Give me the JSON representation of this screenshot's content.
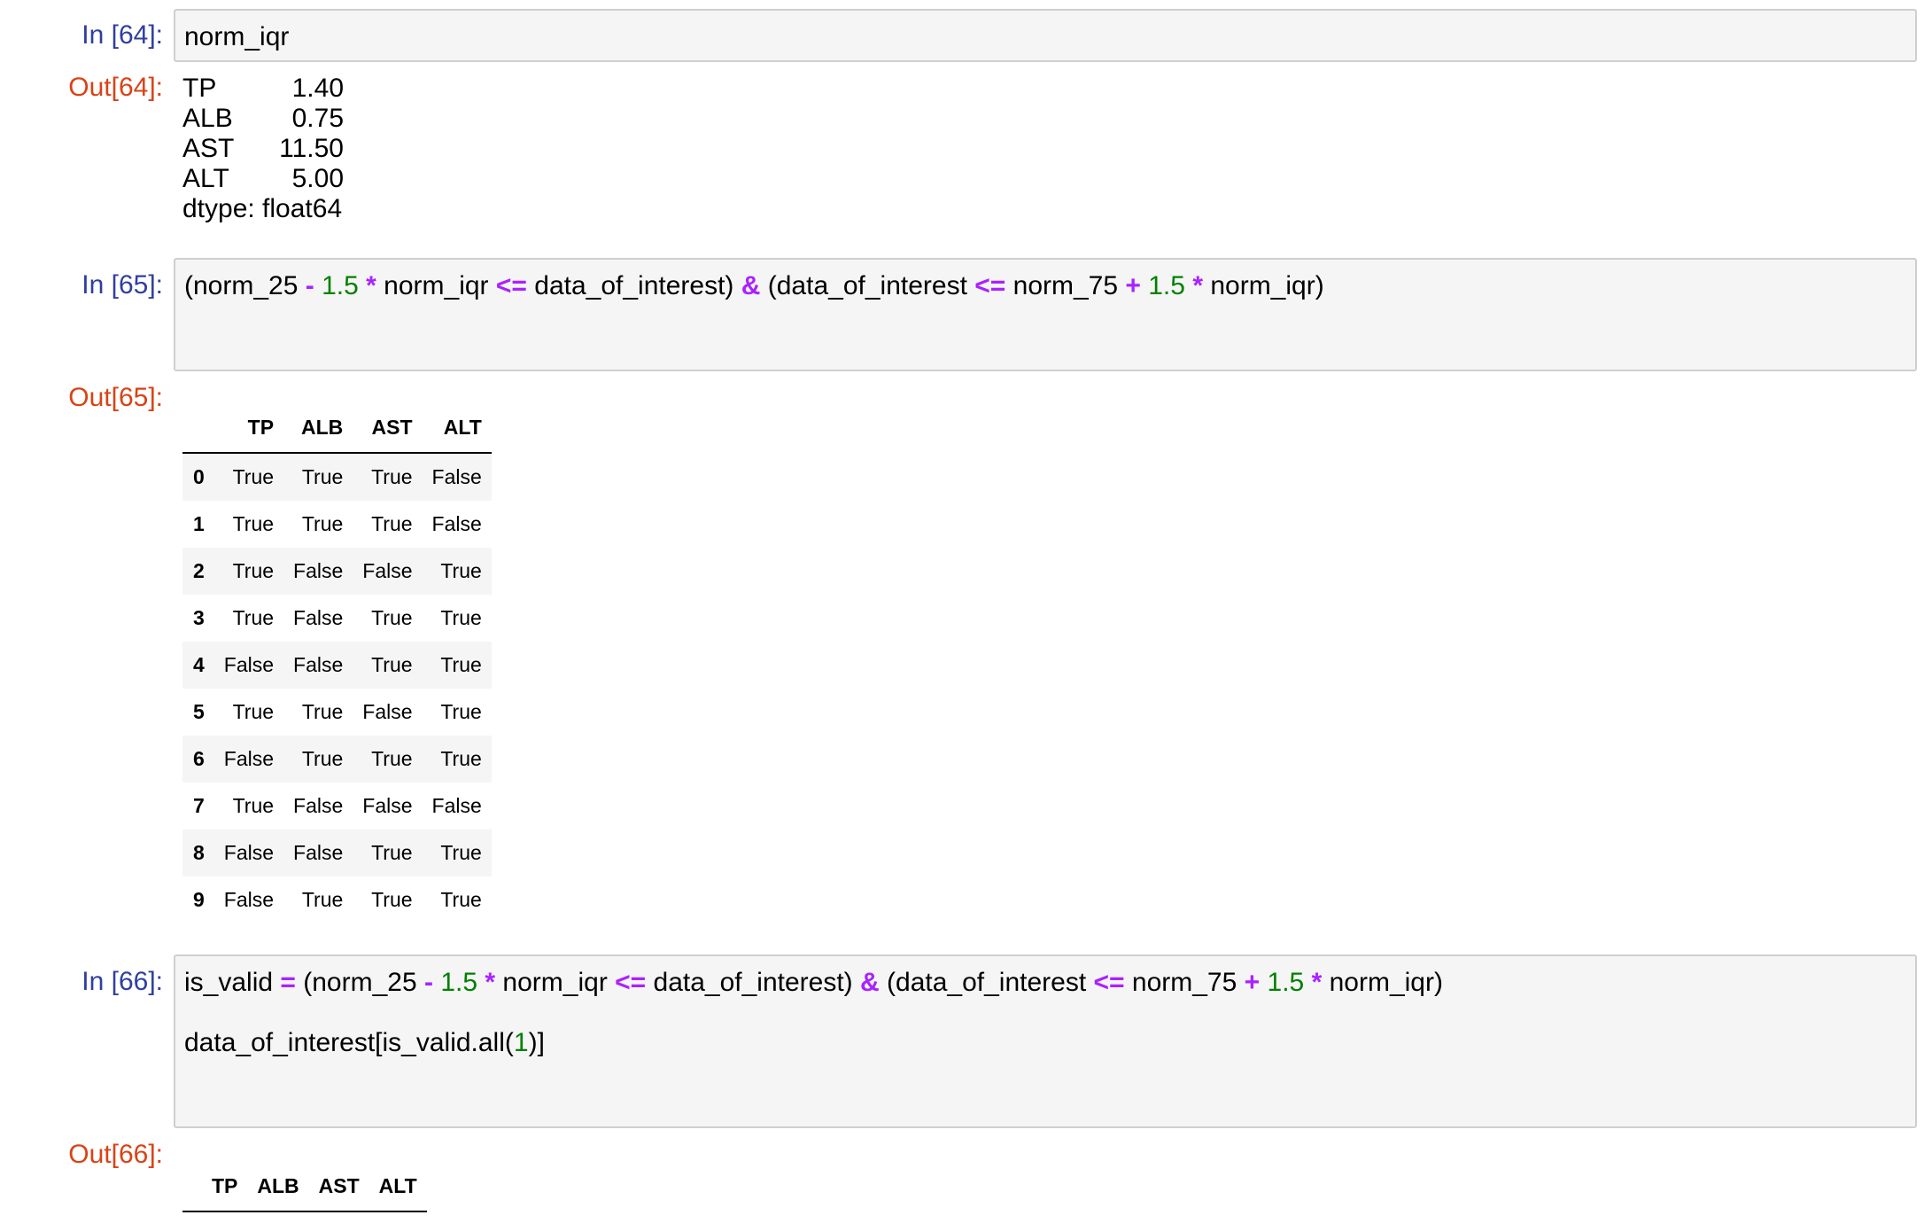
{
  "cells": [
    {
      "in_prompt": "In [64]:",
      "code_lines": [
        [
          {
            "t": "norm_iqr",
            "k": "plain"
          }
        ]
      ],
      "out_prompt": "Out[64]:",
      "series": [
        {
          "key": "TP",
          "value": "1.40"
        },
        {
          "key": "ALB",
          "value": "0.75"
        },
        {
          "key": "AST",
          "value": "11.50"
        },
        {
          "key": "ALT",
          "value": "5.00"
        }
      ],
      "dtype": "dtype: float64"
    },
    {
      "in_prompt": "In [65]:",
      "code_lines": [
        [
          {
            "t": "(norm_25 ",
            "k": "plain"
          },
          {
            "t": "-",
            "k": "op"
          },
          {
            "t": " ",
            "k": "plain"
          },
          {
            "t": "1.5",
            "k": "num"
          },
          {
            "t": " ",
            "k": "plain"
          },
          {
            "t": "*",
            "k": "op"
          },
          {
            "t": " norm_iqr ",
            "k": "plain"
          },
          {
            "t": "<=",
            "k": "op"
          },
          {
            "t": " data_of_interest) ",
            "k": "plain"
          },
          {
            "t": "&",
            "k": "op"
          },
          {
            "t": " (data_of_interest ",
            "k": "plain"
          },
          {
            "t": "<=",
            "k": "op"
          },
          {
            "t": " norm_75 ",
            "k": "plain"
          },
          {
            "t": "+",
            "k": "op"
          },
          {
            "t": " ",
            "k": "plain"
          },
          {
            "t": "1.5",
            "k": "num"
          },
          {
            "t": " ",
            "k": "plain"
          },
          {
            "t": "*",
            "k": "op"
          },
          {
            "t": " norm_iqr)",
            "k": "plain"
          }
        ]
      ],
      "out_prompt": "Out[65]:",
      "table": {
        "columns": [
          "TP",
          "ALB",
          "AST",
          "ALT"
        ],
        "rows": [
          {
            "index": "0",
            "values": [
              "True",
              "True",
              "True",
              "False"
            ]
          },
          {
            "index": "1",
            "values": [
              "True",
              "True",
              "True",
              "False"
            ]
          },
          {
            "index": "2",
            "values": [
              "True",
              "False",
              "False",
              "True"
            ]
          },
          {
            "index": "3",
            "values": [
              "True",
              "False",
              "True",
              "True"
            ]
          },
          {
            "index": "4",
            "values": [
              "False",
              "False",
              "True",
              "True"
            ]
          },
          {
            "index": "5",
            "values": [
              "True",
              "True",
              "False",
              "True"
            ]
          },
          {
            "index": "6",
            "values": [
              "False",
              "True",
              "True",
              "True"
            ]
          },
          {
            "index": "7",
            "values": [
              "True",
              "False",
              "False",
              "False"
            ]
          },
          {
            "index": "8",
            "values": [
              "False",
              "False",
              "True",
              "True"
            ]
          },
          {
            "index": "9",
            "values": [
              "False",
              "True",
              "True",
              "True"
            ]
          }
        ]
      }
    },
    {
      "in_prompt": "In [66]:",
      "code_lines": [
        [
          {
            "t": "is_valid ",
            "k": "plain"
          },
          {
            "t": "=",
            "k": "op"
          },
          {
            "t": " (norm_25 ",
            "k": "plain"
          },
          {
            "t": "-",
            "k": "op"
          },
          {
            "t": " ",
            "k": "plain"
          },
          {
            "t": "1.5",
            "k": "num"
          },
          {
            "t": " ",
            "k": "plain"
          },
          {
            "t": "*",
            "k": "op"
          },
          {
            "t": " norm_iqr ",
            "k": "plain"
          },
          {
            "t": "<=",
            "k": "op"
          },
          {
            "t": " data_of_interest) ",
            "k": "plain"
          },
          {
            "t": "&",
            "k": "op"
          },
          {
            "t": " (data_of_interest ",
            "k": "plain"
          },
          {
            "t": "<=",
            "k": "op"
          },
          {
            "t": " norm_75 ",
            "k": "plain"
          },
          {
            "t": "+",
            "k": "op"
          },
          {
            "t": " ",
            "k": "plain"
          },
          {
            "t": "1.5",
            "k": "num"
          },
          {
            "t": " ",
            "k": "plain"
          },
          {
            "t": "*",
            "k": "op"
          },
          {
            "t": " norm_iqr)",
            "k": "plain"
          }
        ],
        [],
        [
          {
            "t": "data_of_interest[is_valid.all(",
            "k": "plain"
          },
          {
            "t": "1",
            "k": "num"
          },
          {
            "t": ")]",
            "k": "plain"
          }
        ]
      ],
      "out_prompt": "Out[66]:",
      "table": {
        "columns": [
          "TP",
          "ALB",
          "AST",
          "ALT"
        ],
        "rows": []
      }
    }
  ],
  "colors": {
    "in_prompt": "#303f9f",
    "out_prompt": "#d84315",
    "operator": "#aa22ff",
    "number": "#008000",
    "input_bg": "#f5f5f5",
    "input_border": "#cfcfcf"
  }
}
